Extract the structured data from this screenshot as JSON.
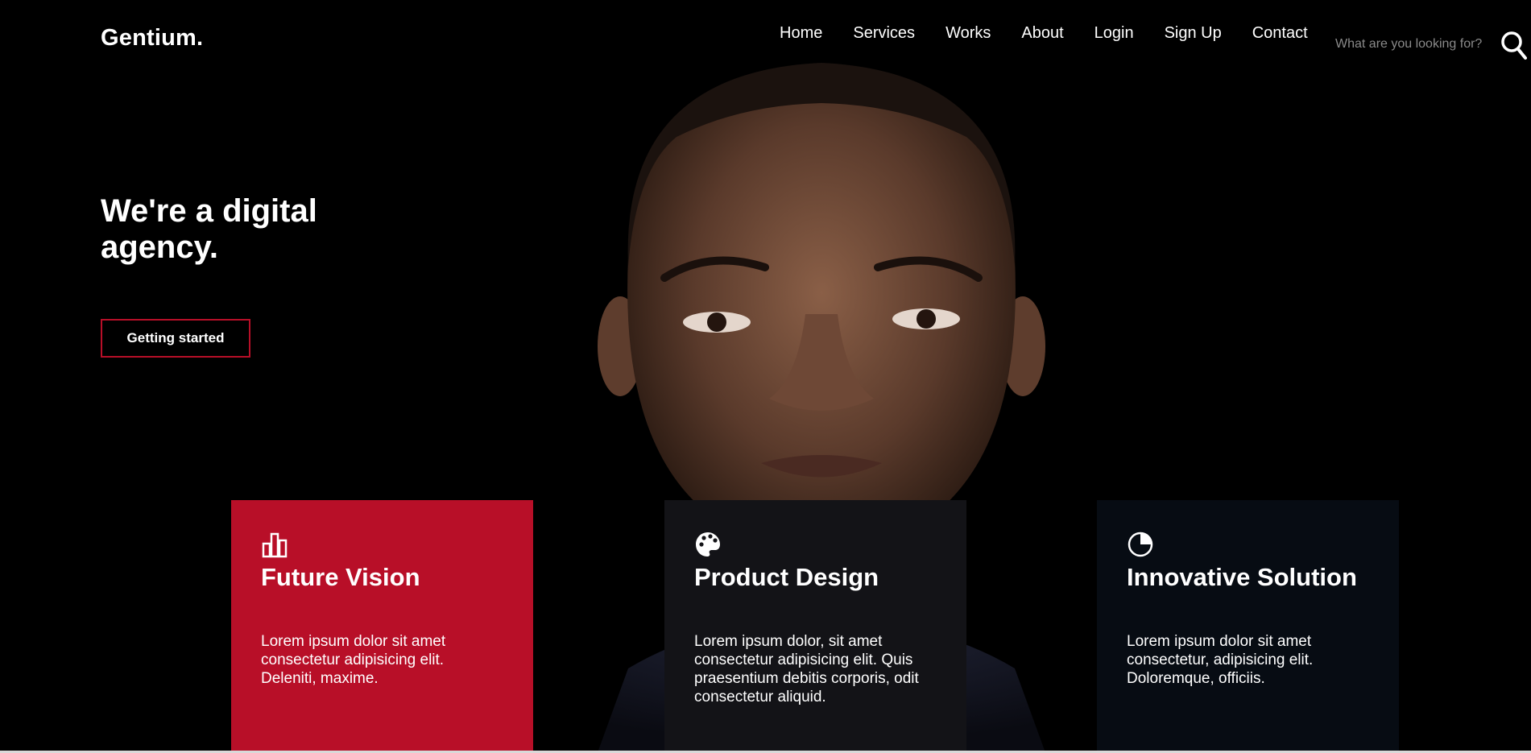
{
  "header": {
    "logo": "Gentium.",
    "nav": [
      "Home",
      "Services",
      "Works",
      "About",
      "Login",
      "Sign Up",
      "Contact"
    ],
    "search_placeholder": "What are you looking for?"
  },
  "hero": {
    "title": "We're a digital agency.",
    "cta_label": "Getting started"
  },
  "cards": [
    {
      "icon": "bar-chart-icon",
      "title": "Future Vision",
      "text": "Lorem ipsum dolor sit amet consectetur adipisicing elit. Deleniti, maxime."
    },
    {
      "icon": "palette-icon",
      "title": "Product Design",
      "text": "Lorem ipsum dolor, sit amet consectetur adipisicing elit. Quis praesentium debitis corporis, odit consectetur aliquid."
    },
    {
      "icon": "pie-chart-icon",
      "title": "Innovative Solution",
      "text": "Lorem ipsum dolor sit amet consectetur, adipisicing elit. Doloremque, officiis."
    }
  ],
  "colors": {
    "accent": "#b80f28",
    "background": "#000000",
    "card_dark": "#131317",
    "card_darker": "#070c13"
  }
}
